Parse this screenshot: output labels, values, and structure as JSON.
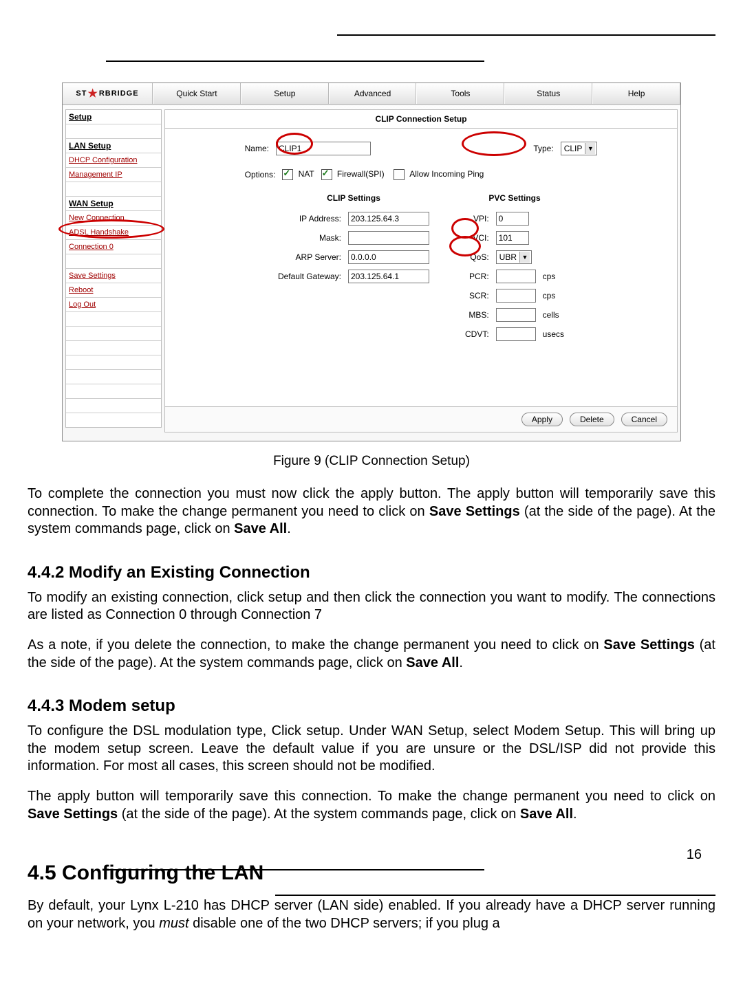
{
  "page_number": "16",
  "router": {
    "logo_text_left": "ST",
    "logo_text_right": "RBRIDGE",
    "tabs": [
      "Quick Start",
      "Setup",
      "Advanced",
      "Tools",
      "Status",
      "Help"
    ],
    "sidebar": {
      "title": "Setup",
      "lan_header": "LAN Setup",
      "lan_items": [
        "DHCP Configuration",
        "Management IP"
      ],
      "wan_header": "WAN Setup",
      "wan_items": [
        "New Connection",
        "ADSL Handshake",
        "Connection 0"
      ],
      "foot_items": [
        "Save Settings",
        "Reboot",
        "Log Out"
      ]
    },
    "panel": {
      "title": "CLIP Connection Setup",
      "name_label": "Name:",
      "name_value": "CLIP1",
      "type_label": "Type:",
      "type_value": "CLIP",
      "options_label": "Options:",
      "opt_nat": "NAT",
      "opt_fw": "Firewall(SPI)",
      "opt_ping": "Allow Incoming Ping",
      "clip_title": "CLIP Settings",
      "clip": {
        "ip_label": "IP Address:",
        "ip_value": "203.125.64.3",
        "mask_label": "Mask:",
        "mask_value": "",
        "arp_label": "ARP Server:",
        "arp_value": "0.0.0.0",
        "gw_label": "Default Gateway:",
        "gw_value": "203.125.64.1"
      },
      "pvc_title": "PVC Settings",
      "pvc": {
        "vpi_label": "VPI:",
        "vpi_value": "0",
        "vci_label": "VCI:",
        "vci_value": "101",
        "qos_label": "QoS:",
        "qos_value": "UBR",
        "pcr_label": "PCR:",
        "pcr_value": "",
        "pcr_unit": "cps",
        "scr_label": "SCR:",
        "scr_value": "",
        "scr_unit": "cps",
        "mbs_label": "MBS:",
        "mbs_value": "",
        "mbs_unit": "cells",
        "cdvt_label": "CDVT:",
        "cdvt_value": "",
        "cdvt_unit": "usecs"
      },
      "actions": {
        "apply": "Apply",
        "delete": "Delete",
        "cancel": "Cancel"
      }
    }
  },
  "caption": "Figure 9 (CLIP Connection Setup)",
  "p1a": "To complete the connection you must now click the apply button.  The apply button will temporarily save this connection. To make the change permanent you need to click on ",
  "p1b": "Save Settings",
  "p1c": " (at the side of the page).  At the system commands page, click on ",
  "p1d": "Save All",
  "p1e": ".",
  "h442": "4.4.2  Modify an Existing Connection",
  "p2": "To modify an existing connection, click setup and then click the connection you want to modify.  The connections are listed as Connection 0 through Connection 7",
  "p3a": "As a note, if you delete the connection, to make the change permanent you need to click on ",
  "p3b": "Save Settings",
  "p3c": " (at the side of the page).  At the system commands page, click on ",
  "p3d": "Save All",
  "p3e": ".",
  "h443": "4.4.3  Modem setup",
  "p4": "To configure the DSL modulation type, Click setup.  Under WAN Setup, select Modem Setup.  This will bring up the modem setup screen.  Leave the default value if you are unsure or the DSL/ISP did not provide this information.   For most all cases, this screen should not be modified.",
  "p5a": "The apply button will temporarily save this connection. To make the change permanent you need to click on ",
  "p5b": "Save Settings",
  "p5c": " (at the side of the page).  At the system commands page, click on ",
  "p5d": "Save All",
  "p5e": ".",
  "h45": "4.5    Configuring the LAN",
  "p6a": "By default, your Lynx L-210 has DHCP server (LAN side) enabled. If you already have a DHCP server running on your network, you ",
  "p6b": "must",
  "p6c": " disable one of the two DHCP servers; if you plug a"
}
